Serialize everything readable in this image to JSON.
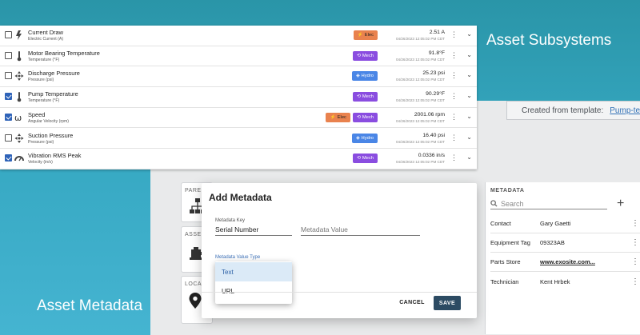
{
  "headlines": {
    "subsystems": "Asset Subsystems",
    "metadata": "Asset Metadata"
  },
  "template_bar": {
    "prefix": "Created from template:",
    "link": "Pump-template",
    "icon": "layers-icon"
  },
  "cards": {
    "parent_label": "PAREN",
    "asset_label": "ASSE",
    "location_label": "LOCA"
  },
  "metadata_panel": {
    "title": "METADATA",
    "search_placeholder": "Search",
    "rows": [
      {
        "key": "Contact",
        "value": "Gary Gaetti",
        "link": false
      },
      {
        "key": "Equipment Tag",
        "value": "09323AB",
        "link": false
      },
      {
        "key": "Parts Store",
        "value": "www.exosite.com...",
        "link": true
      },
      {
        "key": "Technician",
        "value": "Kent Hrbek",
        "link": false
      }
    ]
  },
  "subsystems": [
    {
      "name": "Current Draw",
      "sub": "Electric Current (A)",
      "checked": false,
      "icon": "current-icon",
      "tags": [
        "Elec"
      ],
      "value": "2.51 A",
      "ts": "04/26/2023 12:05:02 PM CDT"
    },
    {
      "name": "Motor Bearing Temperature",
      "sub": "Temperature (°F)",
      "checked": false,
      "icon": "thermometer-icon",
      "tags": [
        "Mech"
      ],
      "value": "91.8°F",
      "ts": "04/26/2023 12:05:02 PM CDT"
    },
    {
      "name": "Discharge Pressure",
      "sub": "Pressure (psi)",
      "checked": false,
      "icon": "pressure-icon",
      "tags": [
        "Hydro"
      ],
      "value": "25.23 psi",
      "ts": "04/26/2023 12:05:02 PM CDT"
    },
    {
      "name": "Pump Temperature",
      "sub": "Temperature (°F)",
      "checked": true,
      "icon": "thermometer-icon",
      "tags": [
        "Mech"
      ],
      "value": "90.29°F",
      "ts": "04/26/2023 12:05:02 PM CDT"
    },
    {
      "name": "Speed",
      "sub": "Angular Velocity (rpm)",
      "checked": true,
      "icon": "omega-icon",
      "tags": [
        "Elec",
        "Mech"
      ],
      "value": "2001.06 rpm",
      "ts": "04/26/2023 12:05:02 PM CDT"
    },
    {
      "name": "Suction Pressure",
      "sub": "Pressure (psi)",
      "checked": false,
      "icon": "pressure-icon",
      "tags": [
        "Hydro"
      ],
      "value": "16.40 psi",
      "ts": "04/26/2023 12:05:02 PM CDT"
    },
    {
      "name": "Vibration RMS Peak",
      "sub": "Velocity (in/s)",
      "checked": true,
      "icon": "gauge-icon",
      "tags": [
        "Mech"
      ],
      "value": "0.0336 in/s",
      "ts": "04/26/2023 12:05:02 PM CDT"
    }
  ],
  "modal": {
    "title": "Add Metadata",
    "key_label": "Metadata Key",
    "key_value": "Serial Number",
    "value_placeholder": "Metadata Value",
    "type_label": "Metadata Value Type",
    "options": [
      "Text",
      "URL"
    ],
    "selected_option": "Text",
    "cancel": "CANCEL",
    "save": "SAVE"
  },
  "colors": {
    "elec": "#e9824e",
    "mech": "#8a4de0",
    "hydro": "#4a86e6",
    "save_button": "#2c4b63",
    "checkbox": "#2f63b8"
  }
}
